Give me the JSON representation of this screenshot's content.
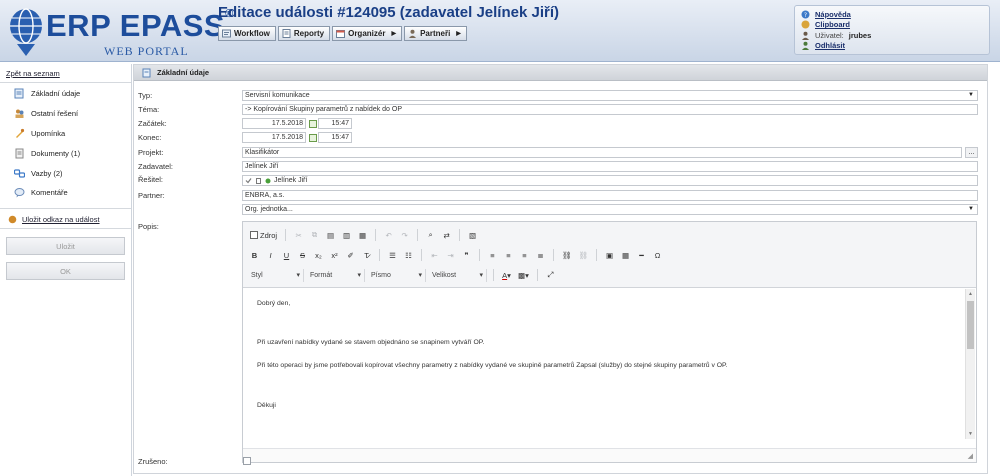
{
  "header": {
    "logo_text": "ERP EPASS",
    "logo_reg": "®",
    "logo_sub": "WEB PORTAL",
    "title": "Editace události #124095 (zadavatel Jelínek Jiří)",
    "menu": [
      {
        "label": "Workflow",
        "icon": "workflow-icon"
      },
      {
        "label": "Reporty",
        "icon": "reports-icon"
      },
      {
        "label": "Organizér",
        "icon": "organizer-icon"
      },
      {
        "label": "Partneři",
        "icon": "partners-icon"
      }
    ],
    "user_panel": {
      "help": "Nápověda",
      "clipboard": "Clipboard",
      "user_label": "Uživatel:",
      "user_name": "jrubes",
      "logout": "Odhlásit"
    }
  },
  "sidebar": {
    "back_link": "Zpět na seznam",
    "items": [
      {
        "label": "Základní údaje",
        "icon": "document-edit-icon"
      },
      {
        "label": "Ostatní řešení",
        "icon": "people-icon"
      },
      {
        "label": "Upomínka",
        "icon": "reminder-icon"
      },
      {
        "label": "Dokumenty (1)",
        "icon": "documents-icon"
      },
      {
        "label": "Vazby (2)",
        "icon": "links-icon"
      },
      {
        "label": "Komentáře",
        "icon": "comments-icon"
      }
    ],
    "save_link": "Uložit odkaz na událost",
    "save_button": "Uložit",
    "ok_button": "OK"
  },
  "panel": {
    "title": "Základní údaje"
  },
  "form": {
    "labels": {
      "type": "Typ:",
      "topic": "Téma:",
      "start": "Začátek:",
      "end": "Konec:",
      "project": "Projekt:",
      "requester": "Zadavatel:",
      "solver": "Řešitel:",
      "partner": "Partner:",
      "description": "Popis:",
      "cancelled": "Zrušeno:"
    },
    "type_value": "Servisní komunikace",
    "topic_value": "-> Kopírování Skupiny parametrů z nabídek do OP",
    "start_date": "17.5.2018",
    "start_time": "15:47",
    "end_date": "17.5.2018",
    "end_time": "15:47",
    "project_value": "Klasifikátor",
    "project_button": "...",
    "requester_value": "Jelínek Jiří",
    "solver_value": "Jelínek Jiří",
    "partner_value": "ENBRA, a.s.",
    "org_unit_placeholder": "Org. jednotka..."
  },
  "editor": {
    "source_label": "Zdroj",
    "combos": {
      "style": "Styl",
      "format": "Formát",
      "font": "Písmo",
      "size": "Velikost"
    },
    "content": [
      "Dobrý den,",
      "Při uzavření nabídky vydané se stavem objednáno se snapinem vytváří OP.",
      "Při této operaci  by jsme potřebovali kopírovat všechny parametry z nabídky vydané ve skupině parametrů Zapsal (služby) do stejné skupiny parametrů v OP.",
      "Děkuji"
    ]
  },
  "colors": {
    "brand": "#1d4d9b",
    "header_bg": "#c9d5e6",
    "panel_head": "#d6dade"
  }
}
